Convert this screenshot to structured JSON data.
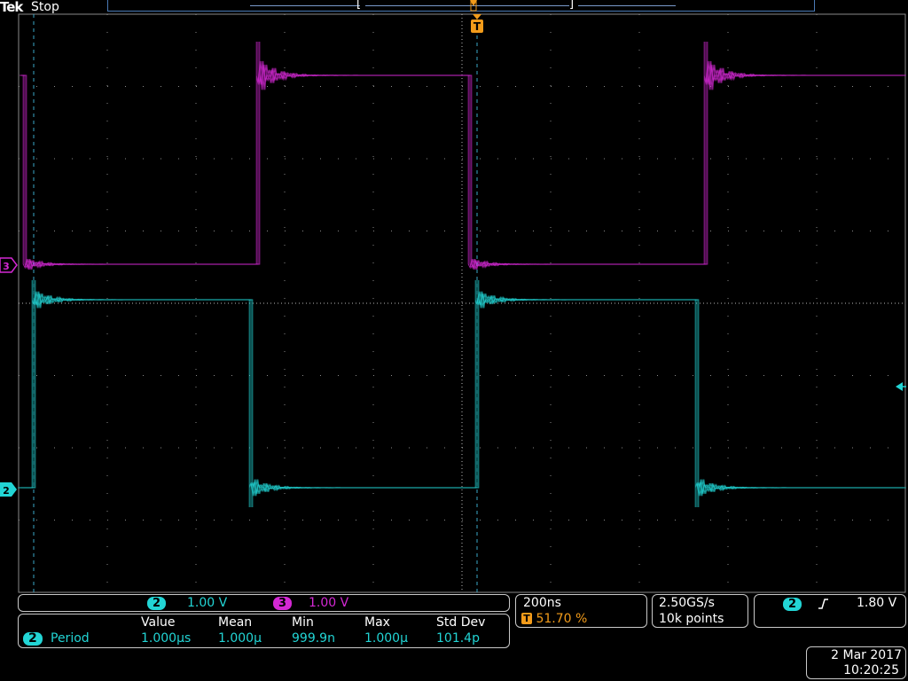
{
  "header": {
    "brand": "Tek",
    "run_state": "Stop"
  },
  "channels": {
    "ch2": {
      "label": "2",
      "scale": "1.00 V",
      "color": "#22d5d5"
    },
    "ch3": {
      "label": "3",
      "scale": "1.00 V",
      "color": "#d428d4"
    }
  },
  "markers": {
    "trigger_marker": "T",
    "ch2_ground": "2",
    "ch3_ground": "3"
  },
  "timebase": {
    "time_per_div": "200ns",
    "trigger_position_icon": "T",
    "trigger_position": "51.70 %",
    "sample_rate": "2.50GS/s",
    "record_length": "10k points"
  },
  "trigger": {
    "source": "2",
    "slope_icon": "rising-edge",
    "level": "1.80 V"
  },
  "measurements": {
    "columns": [
      "Value",
      "Mean",
      "Min",
      "Max",
      "Std Dev"
    ],
    "rows": [
      {
        "channel": "2",
        "name": "Period",
        "values": [
          "1.000µs",
          "1.000µ",
          "999.9n",
          "1.000µ",
          "101.4p"
        ]
      }
    ]
  },
  "datetime": {
    "date": "2 Mar 2017",
    "time": "10:20:25"
  },
  "colors": {
    "ch2": "#22d5d5",
    "ch3": "#d428d4",
    "accent": "#f29b1a",
    "grid": "#8a8a8a"
  }
}
